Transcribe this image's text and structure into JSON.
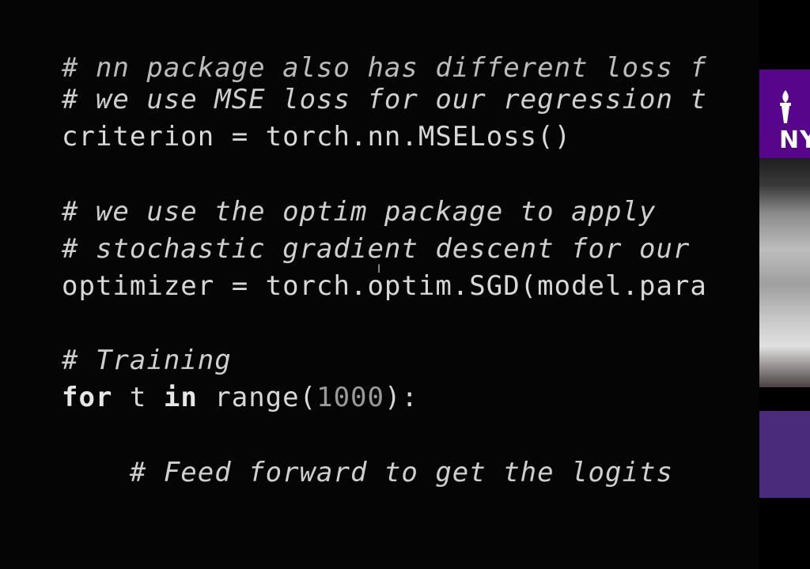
{
  "code": {
    "lines": {
      "l0": "# nn package also has different loss f",
      "l1": "# we use MSE loss for our regression t",
      "l2a": "criterion = torch.nn.MSELoss()",
      "l3": "# we use the optim package to apply",
      "l4": "# stochastic gradient descent for our",
      "l5a": "optimizer = torch.optim.SGD(model.para",
      "l6": "# Training",
      "l7_kw1": "for",
      "l7_var": " t ",
      "l7_kw2": "in",
      "l7_mid": " range(",
      "l7_num": "1000",
      "l7_end": "):",
      "l8": "    # Feed forward to get the logits"
    }
  },
  "sidebar": {
    "logo_text": "NY",
    "brand_color": "#57068c"
  },
  "colors": {
    "background": "#050505",
    "text": "#d8d8d8"
  }
}
